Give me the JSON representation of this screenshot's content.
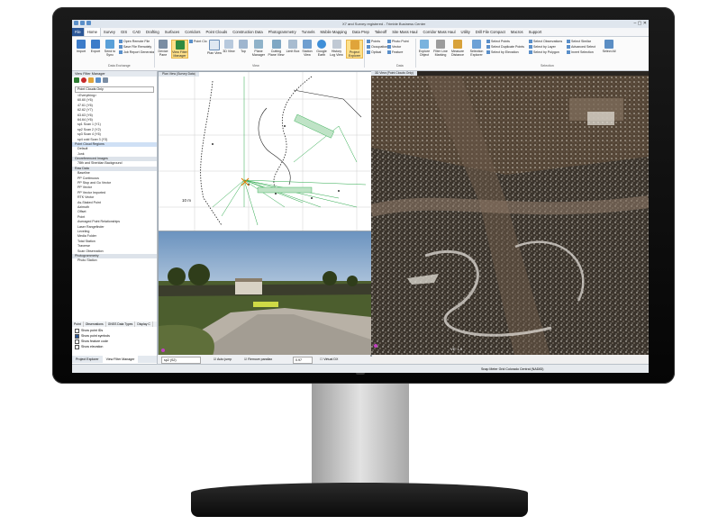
{
  "window": {
    "title": "X7 and Survey registered - Trimble Business Center"
  },
  "menu": [
    "File",
    "Home",
    "Survey",
    "GIS",
    "CAD",
    "Drafting",
    "Surfaces",
    "Corridors",
    "Point Clouds",
    "Construction Data",
    "Photogrammetry",
    "Tunnels",
    "Mobile Mapping",
    "Data Prep",
    "Takeoff",
    "Site Mass Haul",
    "Corridor Mass Haul",
    "Utility",
    "Drill File Compact",
    "Macros",
    "Support"
  ],
  "ribbon": {
    "import": "Import",
    "export": "Export",
    "send_to_sync": "Send to Sync",
    "open_remote_file": "Open Remote File",
    "save_file_remotely": "Save File Remotely",
    "job_report_generator": "Job Report Generator",
    "data_exchange_group": "Data Exchange",
    "device_pane": "Device Pane",
    "view_filter_manager": "View Filter Manager",
    "point_cloud": "Point Clo",
    "plan_view": "Plan View",
    "view_3d": "3D View",
    "top": "Top",
    "plane_manager": "Plane Manager",
    "cutting_plane_view": "Cutting Plane View",
    "limit_box": "Limit Box",
    "station_view": "Station View",
    "google_earth": "Google Earth",
    "history_log_view": "History Log View",
    "project_explorer": "Project Explorer",
    "view_group": "View",
    "points": "Points",
    "vector": "Vector",
    "occupation": "Occupation",
    "optical": "Optical",
    "feature": "Feature",
    "photo_point": "Photo Point",
    "data_group": "Data",
    "explore_object": "Explore Object",
    "filter_line_marking": "Filter Line Marking",
    "measure_distance": "Measure Distance",
    "selection_explorer": "Selection Explorer",
    "select_points": "Select Points",
    "select_duplicate_points": "Select Duplicate Points",
    "select_by_elevation": "Select by Elevation",
    "select_observations": "Select Observations",
    "select_by_layer": "Select by Layer",
    "select_by_polygon": "Select by Polygon",
    "select_similar": "Select Similar",
    "advanced_select": "Advanced Select",
    "invert_selection": "Invert Selection",
    "select_all": "Select All",
    "selection_group": "Selection"
  },
  "left_panel": {
    "title": "View Filter Manager",
    "dropdown_value": "Point Clouds Only",
    "everything": "<Everything>",
    "scans": [
      "60.60 (Y6)",
      "47.61 (Y6)",
      "62.62 (Y7)",
      "63.63 (Y6)",
      "64.64 (Y6)",
      "sp1 Scan 1 (Y1)",
      "sp2 Scan 2 (Y2)",
      "sp3 Scan 4 (Y6)",
      "sp4 cold Scan 3 (Y3)"
    ],
    "sections": {
      "point_cloud_regions": "Point Cloud Regions",
      "georeferenced_images": "Georeferenced Images",
      "raw_data": "Raw Data",
      "photogrammetry": "Photogrammetry"
    },
    "regions": [
      "Default",
      "Junk"
    ],
    "images": [
      "78th and Sheridan Background"
    ],
    "raw_data": [
      "Baseline",
      "PP Continuous",
      "PP Stop and Go Vector",
      "PP Vector",
      "PP Vector Imported",
      "RTK Vector",
      "As-Staked Point",
      "Azimuth",
      "Offset",
      "Point",
      "Averaged Point Relationships",
      "Laser Rangefinder",
      "Leveling",
      "Media Folder",
      "Total Station",
      "Traverse",
      "Scan Observation"
    ],
    "photogrammetry": [
      "Photo Station"
    ],
    "tabs": [
      "Point",
      "Observations",
      "GNSS Data Types",
      "Display C"
    ],
    "checks": [
      "Show point IDs",
      "Show point symbols",
      "Show feature code",
      "Show elevation"
    ],
    "bottom_tabs": [
      "Project Explorer",
      "View Filter Manager"
    ]
  },
  "views": {
    "plan_tab": "Plan View (Survey Data)",
    "station_tab": "Station View (Point Clouds) - sp2",
    "view3d_tab": "3D View (Point Clouds Only)",
    "scale_label": "10 m",
    "ve_label": "VE: 1.0"
  },
  "station_bar": {
    "station": "sp2 (S2)",
    "auto_jump": "Auto jump",
    "remove_parallax": "Remove parallax",
    "value": "0.97",
    "virtual_dx": "Virtual DX"
  },
  "status": {
    "right": "Snap  Meter  Grid  Colorado Central (NAD83)"
  },
  "colors": {
    "file_tab": "#2b5797",
    "highlight": "#fde08a",
    "plan_green": "#2aa84a"
  }
}
